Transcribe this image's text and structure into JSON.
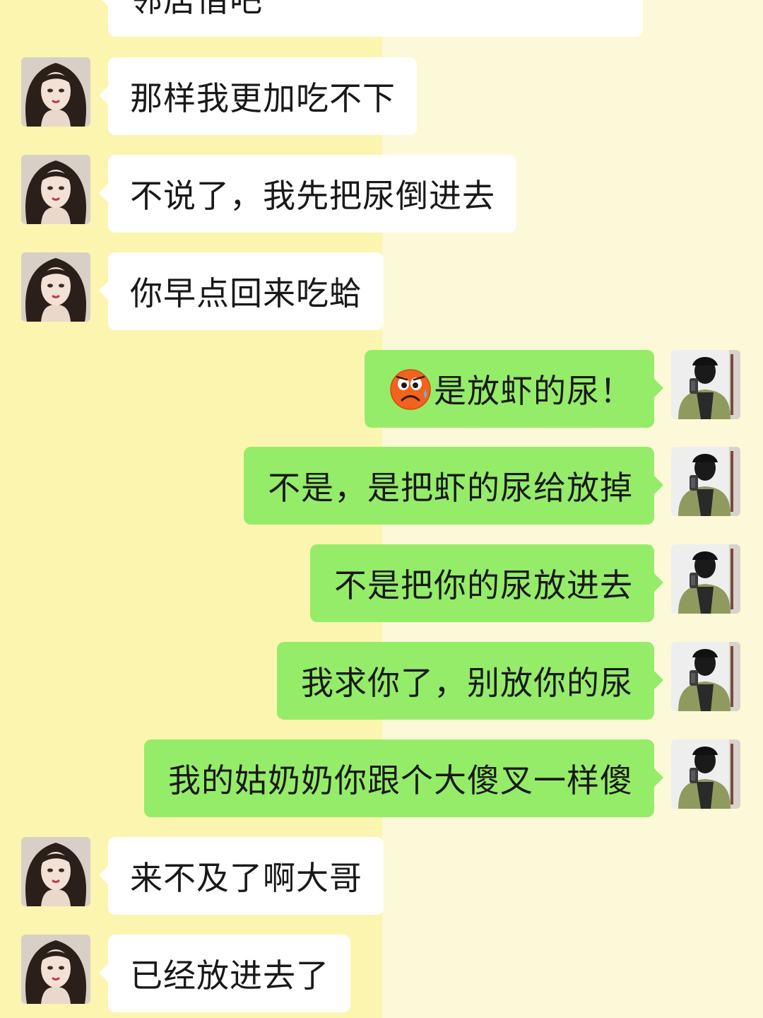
{
  "theme": {
    "background_left": "#fbf5b0",
    "background_right": "#fcf9d8",
    "bubble_incoming": "#ffffff",
    "bubble_outgoing": "#95ec69",
    "text": "#191919"
  },
  "avatars": {
    "contact": "woman-portrait-avatar",
    "self": "masked-man-mirror-selfie-avatar"
  },
  "messages": [
    {
      "side": "left",
      "text": "邻居借吧",
      "partial": true
    },
    {
      "side": "left",
      "text": "那样我更加吃不下"
    },
    {
      "side": "left",
      "text": "不说了，我先把尿倒进去"
    },
    {
      "side": "left",
      "text": "你早点回来吃蛤"
    },
    {
      "side": "right",
      "emoji": "tearful-frown-emoji",
      "text": "是放虾的尿！"
    },
    {
      "side": "right",
      "text": "不是，是把虾的尿给放掉"
    },
    {
      "side": "right",
      "text": "不是把你的尿放进去"
    },
    {
      "side": "right",
      "text": "我求你了，别放你的尿"
    },
    {
      "side": "right",
      "text": "我的姑奶奶你跟个大傻叉一样傻"
    },
    {
      "side": "left",
      "text": "来不及了啊大哥"
    },
    {
      "side": "left",
      "text": "已经放进去了"
    }
  ]
}
